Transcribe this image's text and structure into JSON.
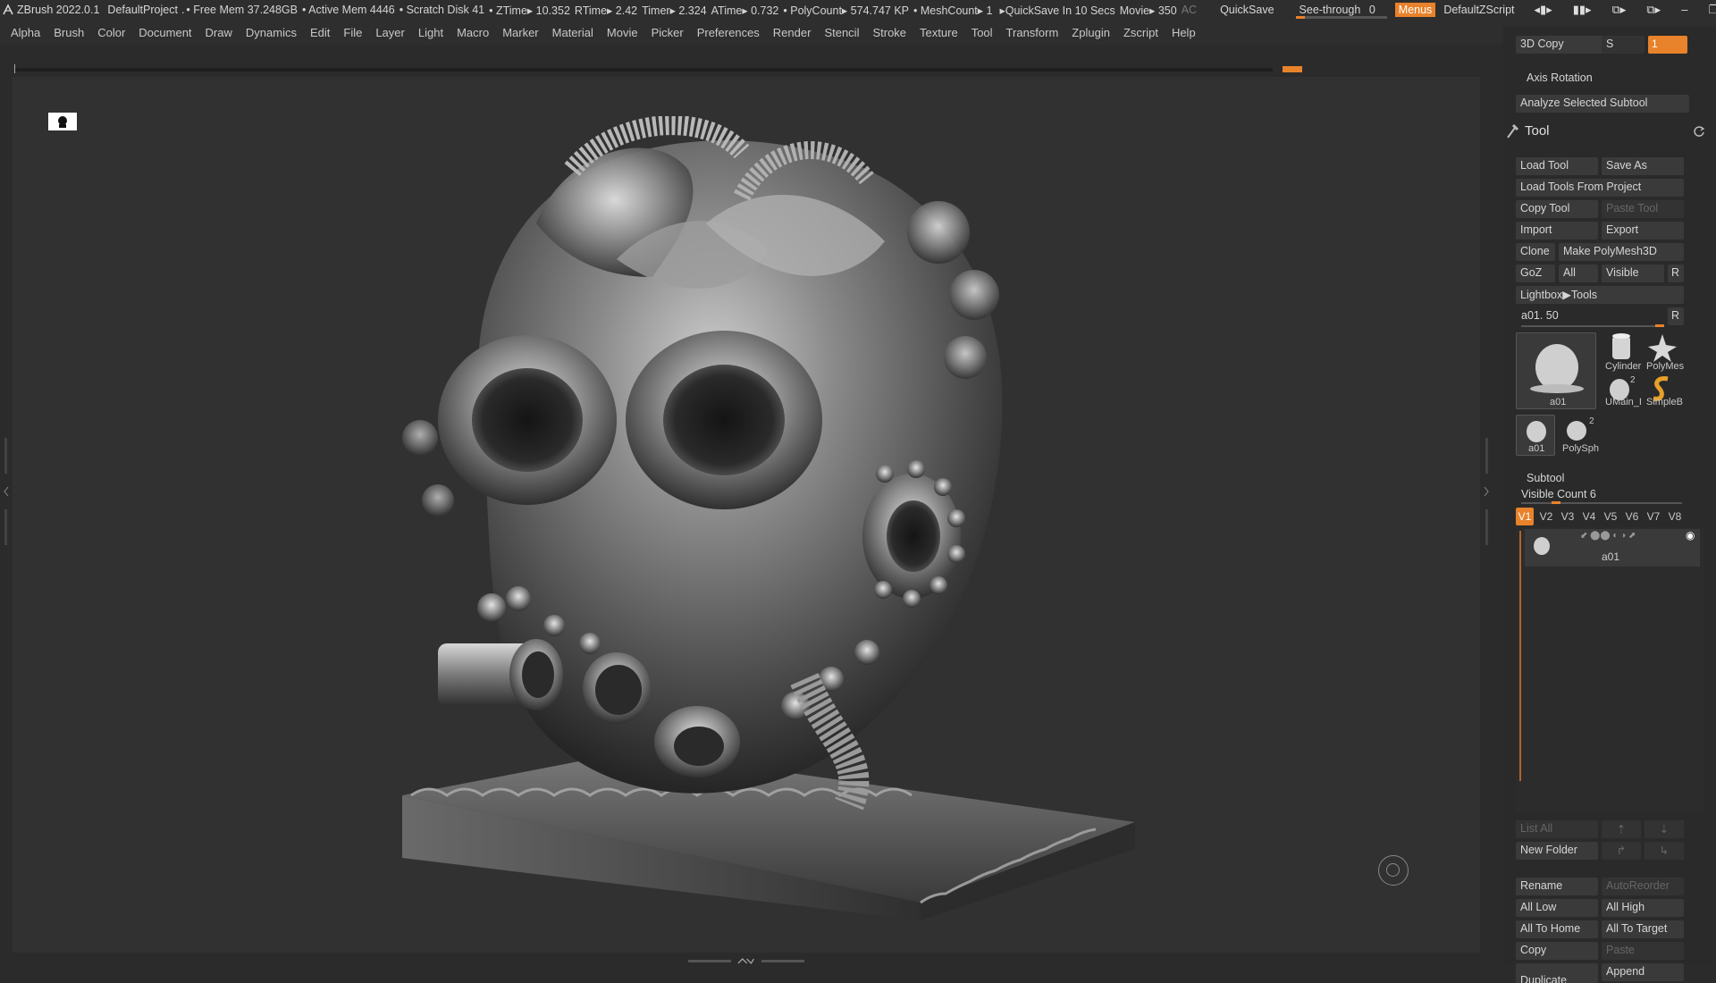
{
  "titlebar": {
    "app": "ZBrush 2022.0.1",
    "project": "DefaultProject",
    "free_mem": "• Free Mem 37.248GB",
    "active_mem": "• Active Mem 4446",
    "scratch_disk": "• Scratch Disk 41",
    "ztime": "• ZTime▸ 10.352",
    "rtime": "RTime▸ 2.42",
    "timer": "Timer▸ 2.324",
    "atime": "ATime▸ 0.732",
    "polycount": "• PolyCount▸ 574.747 KP",
    "meshcount": "• MeshCount▸ 1",
    "quicksave_info": "▸QuickSave In 10 Secs",
    "movie": "Movie▸ 350",
    "ac": "AC",
    "quicksave": "QuickSave",
    "see_through_label": "See-through",
    "see_through_value": "0",
    "menus": "Menus",
    "zscript": "DefaultZScript"
  },
  "menubar": [
    "Alpha",
    "Brush",
    "Color",
    "Document",
    "Draw",
    "Dynamics",
    "Edit",
    "File",
    "Layer",
    "Light",
    "Macro",
    "Marker",
    "Material",
    "Movie",
    "Picker",
    "Preferences",
    "Render",
    "Stencil",
    "Stroke",
    "Texture",
    "Tool",
    "Transform",
    "Zplugin",
    "Zscript",
    "Help"
  ],
  "panel": {
    "top": {
      "copy_3d": "3D Copy",
      "s_label": "S",
      "orange_value": "1",
      "axis_rotation": "Axis Rotation",
      "analyze": "Analyze Selected Subtool"
    },
    "tool": {
      "title": "Tool",
      "load_tool": "Load Tool",
      "save_as": "Save As",
      "load_from_project": "Load Tools From Project",
      "copy_tool": "Copy Tool",
      "paste_tool": "Paste Tool",
      "import": "Import",
      "export": "Export",
      "clone": "Clone",
      "make_polymesh": "Make PolyMesh3D",
      "goz": "GoZ",
      "all": "All",
      "visible": "Visible",
      "r": "R",
      "lightbox_tools": "Lightbox▶Tools",
      "current_tool": "a01. 50",
      "r2": "R",
      "thumbs": {
        "main": "a01",
        "cylinder": "Cylinder",
        "polymesh": "PolyMes",
        "umain": "UMain_I",
        "umain_count": "2",
        "simpleb": "SimpleB",
        "a01_small": "a01",
        "polysph": "PolySph",
        "polysph_count": "2"
      }
    },
    "subtool": {
      "title": "Subtool",
      "visible_count": "Visible Count 6",
      "tabs": [
        "V1",
        "V2",
        "V3",
        "V4",
        "V5",
        "V6",
        "V7",
        "V8"
      ],
      "item_name": "a01",
      "list_all": "List All",
      "new_folder": "New Folder",
      "rename": "Rename",
      "autoreorder": "AutoReorder",
      "all_low": "All Low",
      "all_high": "All High",
      "all_to_home": "All To Home",
      "all_to_target": "All To Target",
      "copy": "Copy",
      "paste": "Paste",
      "duplicate": "Duplicate",
      "append": "Append"
    }
  },
  "colors": {
    "accent": "#e8822b",
    "panel_bg": "#2a2a2a",
    "canvas_bg": "#313131"
  }
}
